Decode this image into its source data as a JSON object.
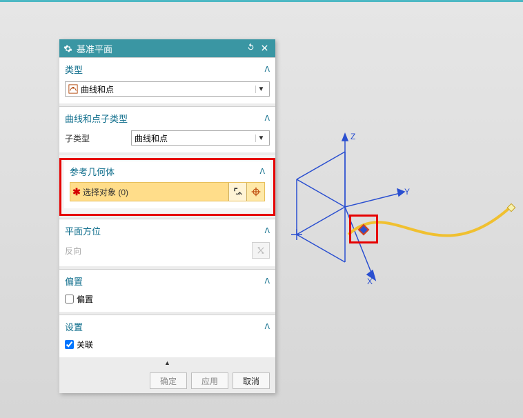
{
  "colors": {
    "accent": "#3a96a3",
    "highlight": "#e60000",
    "select_bg": "#ffdd8a"
  },
  "dialog": {
    "title": "基准平面",
    "sections": {
      "type": {
        "header": "类型",
        "value": "曲线和点",
        "icon": "curve-point-icon"
      },
      "subtype": {
        "header": "曲线和点子类型",
        "label": "子类型",
        "value": "曲线和点"
      },
      "refgeo": {
        "header": "参考几何体",
        "select_prefix": "选择对象",
        "select_count": "(0)"
      },
      "orient": {
        "header": "平面方位",
        "reverse_label": "反向"
      },
      "offset": {
        "header": "偏置",
        "checkbox_label": "偏置",
        "checked": false
      },
      "settings": {
        "header": "设置",
        "checkbox_label": "关联",
        "checked": true
      }
    },
    "buttons": {
      "ok": "确定",
      "apply": "应用",
      "cancel": "取消"
    }
  },
  "viewport": {
    "axes": {
      "x": "X",
      "y": "Y",
      "z": "Z"
    }
  }
}
